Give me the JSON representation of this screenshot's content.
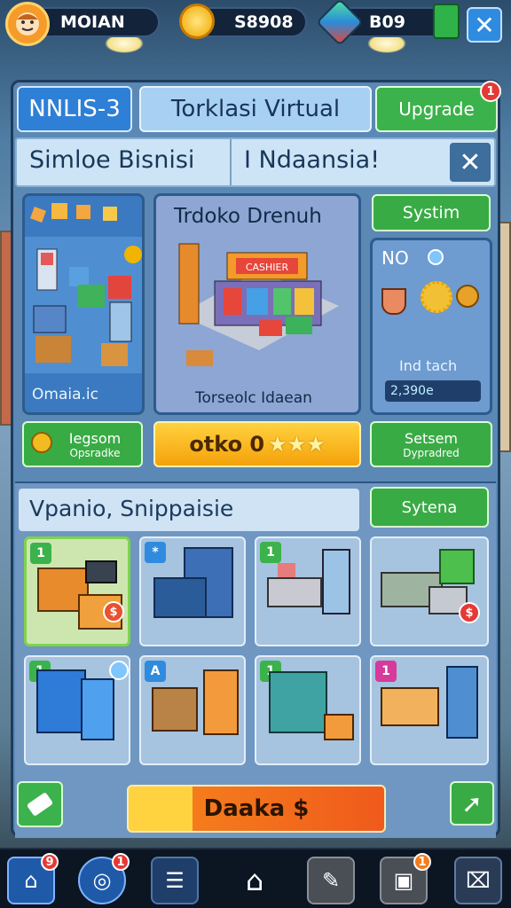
{
  "topbar": {
    "player_name": "MOIAN",
    "coins": "S8908",
    "gems": "B09"
  },
  "tabs": [
    {
      "label": "NNLIS-3"
    },
    {
      "label": "Torklasi Virtual"
    },
    {
      "label": "Upgrade",
      "badge": "1"
    }
  ],
  "subbar": {
    "left": "Simloe  Bisnisi",
    "right": "I Ndaansia!"
  },
  "featured": {
    "left_caption": "Omaia.ic",
    "center_title": "Trdoko Drenuh",
    "center_caption": "Torseolc Idaean",
    "center_sign": "CASHIER",
    "system_button": "Systim",
    "right_top": "NO",
    "right_caption": "Ind tach",
    "right_value": "2,390e",
    "left_button_line1": "Iegsom",
    "left_button_line2": "Opsradke",
    "center_button": "otko 0",
    "right_button_line1": "Setsem",
    "right_button_line2": "Dypradred"
  },
  "shop": {
    "heading": "Vpanio, Snippaisie",
    "system_button": "Sytena",
    "slots": [
      {
        "tag": "1",
        "tag_color": "#3bb24b"
      },
      {
        "tag": "*",
        "tag_color": "#2f8be0"
      },
      {
        "tag": "1",
        "tag_color": "#3bb24b"
      },
      {
        "tag": "",
        "tag_color": ""
      },
      {
        "tag": "1",
        "tag_color": "#3bb24b"
      },
      {
        "tag": "A",
        "tag_color": "#2f8be0"
      },
      {
        "tag": "1",
        "tag_color": "#3bb24b"
      },
      {
        "tag": "1",
        "tag_color": "#d63a9a"
      }
    ],
    "main_button": "Daaka $",
    "badges": {
      "slot1": "$",
      "slot4": "$"
    }
  },
  "nav": {
    "home_badge": "9",
    "profile_badge": "1",
    "camera_badge": "1"
  },
  "colors": {
    "primary_blue": "#2e7fd6",
    "success_green": "#39ab45",
    "accent_yellow": "#f5a10a",
    "badge_red": "#e53935"
  }
}
